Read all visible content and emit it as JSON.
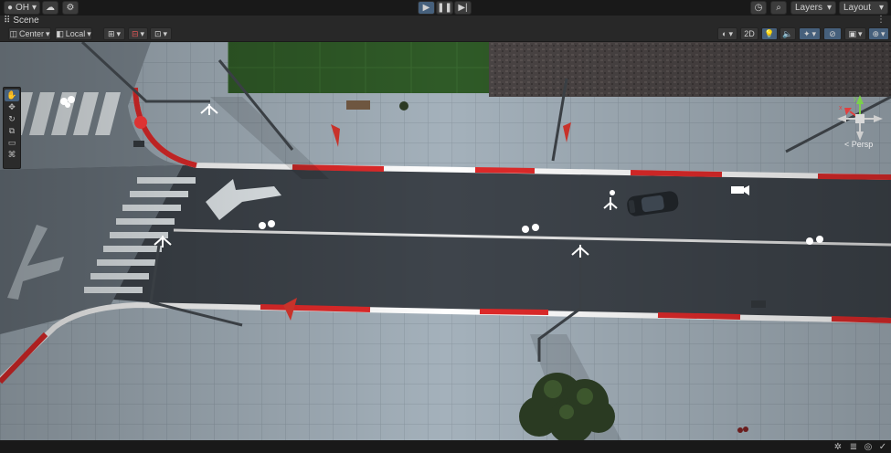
{
  "toolbar": {
    "account_label": "OH",
    "account_icon": "user-icon",
    "cloud_icon": "cloud-icon",
    "collab_icon": "gear-icon",
    "play_icon": "play-icon",
    "pause_icon": "pause-icon",
    "step_icon": "step-icon",
    "history_icon": "history-icon",
    "search_icon": "search-icon",
    "layers_label": "Layers",
    "layout_label": "Layout"
  },
  "scene_tab": {
    "label": "Scene",
    "menu_glyph": "⋮"
  },
  "scene_toolbar": {
    "pivot_label": "Center",
    "space_label": "Local",
    "mode_2d_label": "2D"
  },
  "tools": [
    "hand-tool",
    "move-tool",
    "rotate-tool",
    "scale-tool",
    "rect-tool",
    "transform-tool"
  ],
  "gizmo": {
    "projection_label": "< Persp",
    "axis_y": "y",
    "axis_x": "x"
  },
  "colors": {
    "accent": "#46607c",
    "curb_red": "#e02a2a",
    "grass": "#2f5a27",
    "road": "#3c4249",
    "sidewalk": "#9aa8b3"
  }
}
